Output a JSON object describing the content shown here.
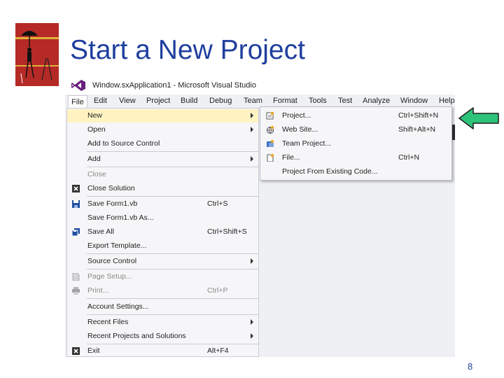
{
  "slide": {
    "title": "Start a New Project",
    "page_number": "8"
  },
  "window": {
    "title": "Window.sxApplication1 - Microsoft Visual Studio"
  },
  "menubar": {
    "items": [
      "File",
      "Edit",
      "View",
      "Project",
      "Build",
      "Debug",
      "Team",
      "Format",
      "Tools",
      "Test",
      "Analyze",
      "Window",
      "Help"
    ]
  },
  "file_menu": {
    "items": [
      {
        "label": "New",
        "shortcut": "",
        "submenu": true,
        "highlighted": true
      },
      {
        "label": "Open",
        "shortcut": "",
        "submenu": true
      },
      {
        "label": "Add to Source Control",
        "shortcut": ""
      },
      {
        "label": "Add",
        "shortcut": "",
        "submenu": true
      },
      {
        "label": "Close",
        "shortcut": "",
        "disabled": true
      },
      {
        "label": "Close Solution",
        "shortcut": "",
        "icon": "close-solution-icon"
      },
      {
        "label": "Save Form1.vb",
        "shortcut": "Ctrl+S",
        "icon": "save-icon"
      },
      {
        "label": "Save Form1.vb As...",
        "shortcut": ""
      },
      {
        "label": "Save All",
        "shortcut": "Ctrl+Shift+S",
        "icon": "save-all-icon"
      },
      {
        "label": "Export Template...",
        "shortcut": ""
      },
      {
        "label": "Source Control",
        "shortcut": "",
        "submenu": true
      },
      {
        "label": "Page Setup...",
        "shortcut": "",
        "disabled": true,
        "icon": "page-setup-icon"
      },
      {
        "label": "Print...",
        "shortcut": "Ctrl+P",
        "disabled": true,
        "icon": "print-icon"
      },
      {
        "label": "Account Settings...",
        "shortcut": ""
      },
      {
        "label": "Recent Files",
        "shortcut": "",
        "submenu": true
      },
      {
        "label": "Recent Projects and Solutions",
        "shortcut": "",
        "submenu": true
      },
      {
        "label": "Exit",
        "shortcut": "Alt+F4",
        "icon": "exit-icon"
      }
    ]
  },
  "new_submenu": {
    "items": [
      {
        "label": "Project...",
        "shortcut": "Ctrl+Shift+N",
        "icon": "new-project-icon"
      },
      {
        "label": "Web Site...",
        "shortcut": "Shift+Alt+N",
        "icon": "web-site-icon"
      },
      {
        "label": "Team Project...",
        "shortcut": "",
        "icon": "team-project-icon"
      },
      {
        "label": "File...",
        "shortcut": "Ctrl+N",
        "icon": "new-file-icon"
      },
      {
        "label": "Project From Existing Code...",
        "shortcut": ""
      }
    ]
  },
  "colors": {
    "title": "#1f3f9e",
    "highlight": "#fff3c2",
    "arrow": "#2ec37a",
    "vs_purple": "#68217a"
  }
}
